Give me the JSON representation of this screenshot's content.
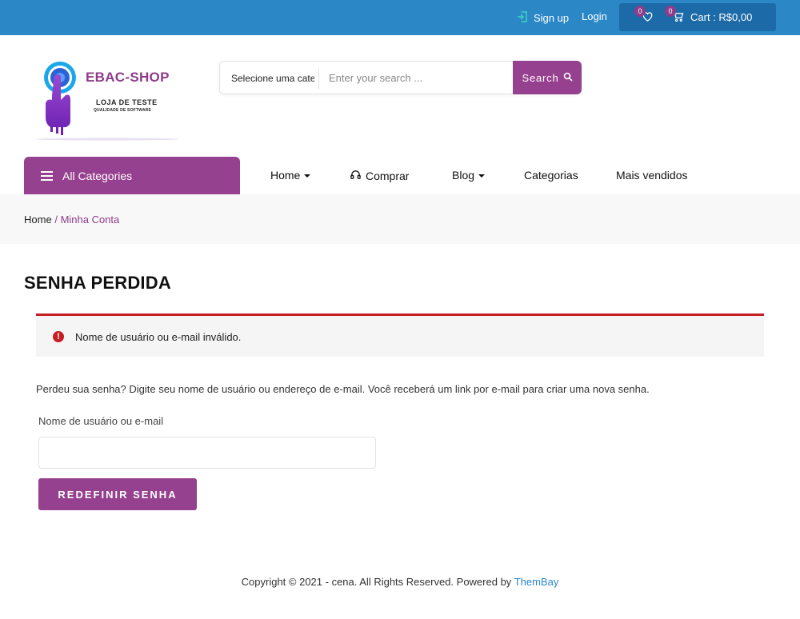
{
  "topbar": {
    "signup_label": "Sign up",
    "login_label": "Login",
    "wishlist_count": "0",
    "cart_count": "0",
    "cart_label": "Cart : R$0,00",
    "bg_color": "#2b87c6"
  },
  "header": {
    "logo_title": "EBAC-SHOP",
    "logo_subtitle": "LOJA DE TESTE",
    "logo_tagline": "QUALIDADE DE SOFTWARE",
    "search": {
      "category_label": "Selecione uma categoria",
      "placeholder": "Enter your search ...",
      "button_label": "Search"
    }
  },
  "nav": {
    "all_categories_label": "All Categories",
    "items": [
      {
        "label": "Home",
        "icon": "chevron-down-icon"
      },
      {
        "label": "Comprar",
        "icon": "headset-icon"
      },
      {
        "label": "Blog",
        "icon": "chevron-down-icon"
      },
      {
        "label": "Categorias"
      },
      {
        "label": "Mais vendidos"
      }
    ]
  },
  "breadcrumb": {
    "home": "Home",
    "separator": "/",
    "current": "Minha Conta"
  },
  "main": {
    "title": "SENHA PERDIDA",
    "error_message": "Nome de usuário ou e-mail inválido.",
    "description": "Perdeu sua senha? Digite seu nome de usuário ou endereço de e-mail. Você receberá um link por e-mail para criar uma nova senha.",
    "field_label": "Nome de usuário ou e-mail",
    "field_value": "",
    "submit_label": "REDEFINIR SENHA"
  },
  "footer": {
    "copyright": "Copyright © 2021 - cena. All Rights Reserved. Powered by",
    "brand": "ThemBay"
  },
  "colors": {
    "accent": "#96418f",
    "error": "#c31f25",
    "link": "#2b87c6"
  }
}
